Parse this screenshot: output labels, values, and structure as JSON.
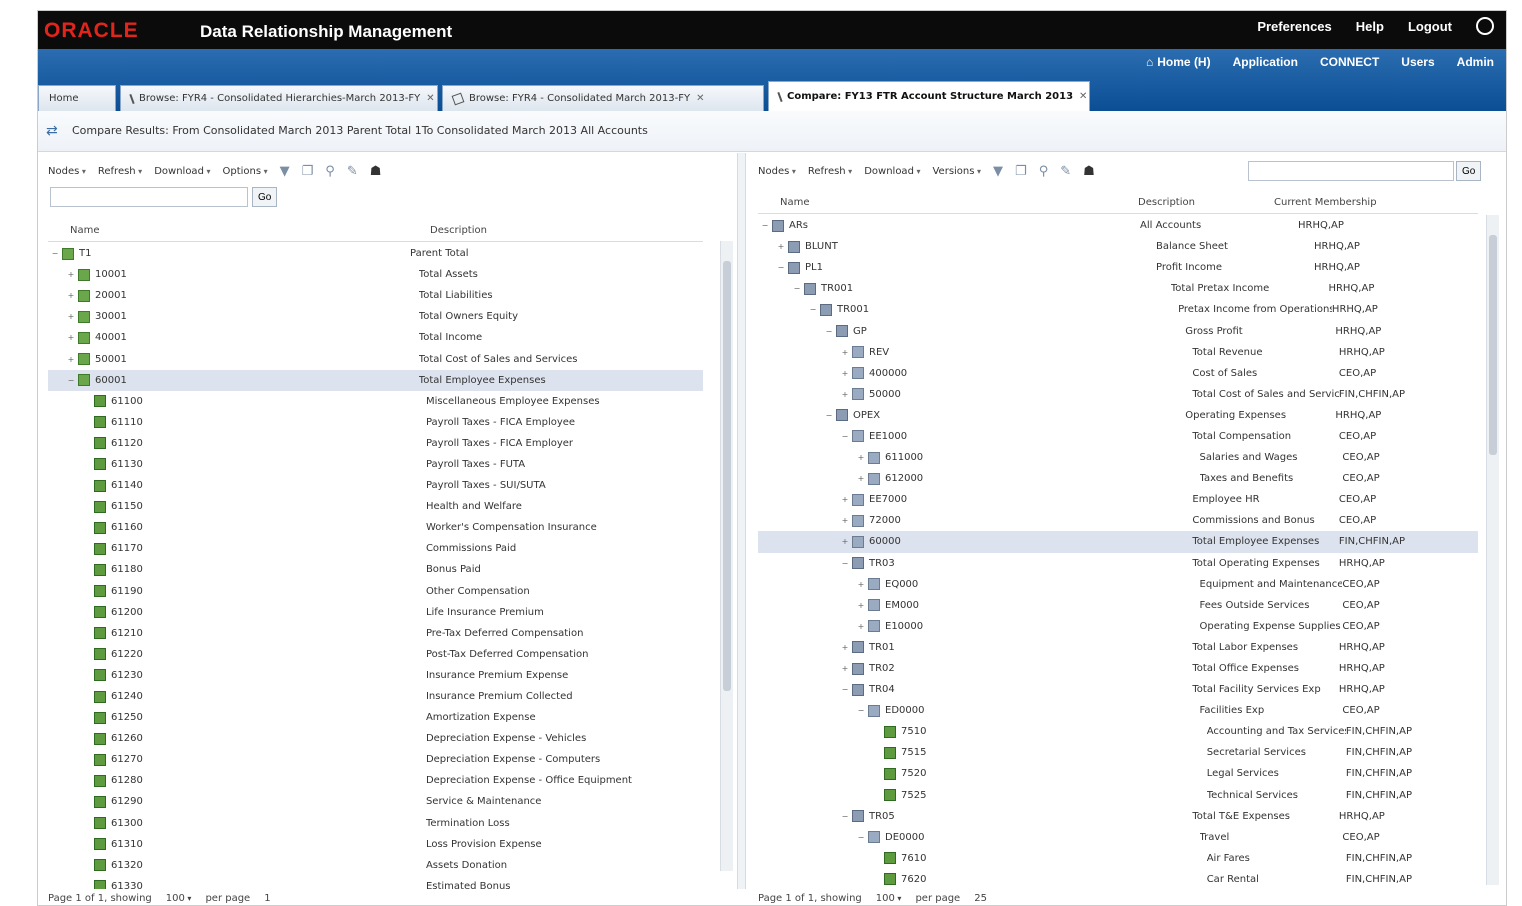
{
  "app": {
    "brand": "ORACLE",
    "product": "Data Relationship Management",
    "top_links": [
      "Preferences",
      "Help",
      "Logout"
    ]
  },
  "nav": {
    "links": [
      "Home (H)",
      "Application",
      "CONNECT",
      "Users",
      "Admin"
    ]
  },
  "tabs": [
    {
      "label": "Home",
      "active": false
    },
    {
      "label": "Browse: FYR4 - Consolidated Hierarchies-March 2013-FY",
      "active": false
    },
    {
      "label": "Browse: FYR4 - Consolidated March 2013-FY",
      "active": false
    },
    {
      "label": "Compare: FY13 FTR Account Structure March 2013",
      "active": true
    }
  ],
  "compare_title": "Compare Results: From Consolidated March 2013 Parent Total 1To Consolidated March 2013 All Accounts",
  "left_pane": {
    "menus": [
      "Nodes",
      "Refresh",
      "Download",
      "Options"
    ],
    "search_button": "Go",
    "columns": [
      "Name",
      "Description"
    ],
    "rows": [
      {
        "exp": "−",
        "icon": "grp",
        "indent": 0,
        "name": "T1",
        "desc": "Parent Total"
      },
      {
        "exp": "+",
        "icon": "grp",
        "indent": 1,
        "name": "10001",
        "desc": "Total Assets"
      },
      {
        "exp": "+",
        "icon": "grp",
        "indent": 1,
        "name": "20001",
        "desc": "Total Liabilities"
      },
      {
        "exp": "+",
        "icon": "grp",
        "indent": 1,
        "name": "30001",
        "desc": "Total Owners Equity"
      },
      {
        "exp": "+",
        "icon": "grp",
        "indent": 1,
        "name": "40001",
        "desc": "Total Income"
      },
      {
        "exp": "+",
        "icon": "grp",
        "indent": 1,
        "name": "50001",
        "desc": "Total Cost of Sales and Services"
      },
      {
        "exp": "−",
        "icon": "grp",
        "indent": 1,
        "name": "60001",
        "desc": "Total Employee Expenses",
        "sel": true
      },
      {
        "exp": "",
        "icon": "leaf",
        "indent": 2,
        "name": "61100",
        "desc": "Miscellaneous Employee Expenses"
      },
      {
        "exp": "",
        "icon": "leaf",
        "indent": 2,
        "name": "61110",
        "desc": "Payroll Taxes - FICA Employee"
      },
      {
        "exp": "",
        "icon": "leaf",
        "indent": 2,
        "name": "61120",
        "desc": "Payroll Taxes - FICA Employer"
      },
      {
        "exp": "",
        "icon": "leaf",
        "indent": 2,
        "name": "61130",
        "desc": "Payroll Taxes - FUTA"
      },
      {
        "exp": "",
        "icon": "leaf",
        "indent": 2,
        "name": "61140",
        "desc": "Payroll Taxes - SUI/SUTA"
      },
      {
        "exp": "",
        "icon": "leaf",
        "indent": 2,
        "name": "61150",
        "desc": "Health and Welfare"
      },
      {
        "exp": "",
        "icon": "leaf",
        "indent": 2,
        "name": "61160",
        "desc": "Worker's Compensation Insurance"
      },
      {
        "exp": "",
        "icon": "leaf",
        "indent": 2,
        "name": "61170",
        "desc": "Commissions Paid"
      },
      {
        "exp": "",
        "icon": "leaf",
        "indent": 2,
        "name": "61180",
        "desc": "Bonus Paid"
      },
      {
        "exp": "",
        "icon": "leaf",
        "indent": 2,
        "name": "61190",
        "desc": "Other Compensation"
      },
      {
        "exp": "",
        "icon": "leaf",
        "indent": 2,
        "name": "61200",
        "desc": "Life Insurance Premium"
      },
      {
        "exp": "",
        "icon": "leaf",
        "indent": 2,
        "name": "61210",
        "desc": "Pre-Tax Deferred Compensation"
      },
      {
        "exp": "",
        "icon": "leaf",
        "indent": 2,
        "name": "61220",
        "desc": "Post-Tax Deferred Compensation"
      },
      {
        "exp": "",
        "icon": "leaf",
        "indent": 2,
        "name": "61230",
        "desc": "Insurance Premium Expense"
      },
      {
        "exp": "",
        "icon": "leaf",
        "indent": 2,
        "name": "61240",
        "desc": "Insurance Premium Collected"
      },
      {
        "exp": "",
        "icon": "leaf",
        "indent": 2,
        "name": "61250",
        "desc": "Amortization Expense"
      },
      {
        "exp": "",
        "icon": "leaf",
        "indent": 2,
        "name": "61260",
        "desc": "Depreciation Expense - Vehicles"
      },
      {
        "exp": "",
        "icon": "leaf",
        "indent": 2,
        "name": "61270",
        "desc": "Depreciation Expense - Computers"
      },
      {
        "exp": "",
        "icon": "leaf",
        "indent": 2,
        "name": "61280",
        "desc": "Depreciation Expense - Office Equipment"
      },
      {
        "exp": "",
        "icon": "leaf",
        "indent": 2,
        "name": "61290",
        "desc": "Service & Maintenance"
      },
      {
        "exp": "",
        "icon": "leaf",
        "indent": 2,
        "name": "61300",
        "desc": "Termination Loss"
      },
      {
        "exp": "",
        "icon": "leaf",
        "indent": 2,
        "name": "61310",
        "desc": "Loss Provision Expense"
      },
      {
        "exp": "",
        "icon": "leaf",
        "indent": 2,
        "name": "61320",
        "desc": "Assets Donation"
      },
      {
        "exp": "",
        "icon": "leaf",
        "indent": 2,
        "name": "61330",
        "desc": "Estimated Bonus"
      }
    ],
    "footer": {
      "page_text": "Page 1 of 1, showing",
      "count": "100",
      "per_page_label": "per page",
      "page_num": "1"
    }
  },
  "right_pane": {
    "menus": [
      "Nodes",
      "Refresh",
      "Download",
      "Versions"
    ],
    "search_button": "Go",
    "columns": [
      "Name",
      "Description",
      "Current Membership"
    ],
    "rows": [
      {
        "exp": "−",
        "icon": "hier",
        "indent": 0,
        "name": "ARs",
        "desc": "All Accounts",
        "role": "HRHQ,AP"
      },
      {
        "exp": "+",
        "icon": "hier",
        "indent": 1,
        "name": "BLUNT",
        "desc": "Balance Sheet",
        "role": "HRHQ,AP"
      },
      {
        "exp": "−",
        "icon": "hier",
        "indent": 1,
        "name": "PL1",
        "desc": "Profit Income",
        "role": "HRHQ,AP"
      },
      {
        "exp": "−",
        "icon": "hier",
        "indent": 2,
        "name": "TR001",
        "desc": "Total Pretax Income",
        "role": "HRHQ,AP"
      },
      {
        "exp": "−",
        "icon": "hier",
        "indent": 3,
        "name": "TR001",
        "desc": "Pretax Income from Operations",
        "role": "HRHQ,AP"
      },
      {
        "exp": "−",
        "icon": "hier",
        "indent": 4,
        "name": "GP",
        "desc": "Gross Profit",
        "role": "HRHQ,AP"
      },
      {
        "exp": "+",
        "icon": "fold",
        "indent": 5,
        "name": "REV",
        "desc": "Total Revenue",
        "role": "HRHQ,AP"
      },
      {
        "exp": "+",
        "icon": "fold",
        "indent": 5,
        "name": "400000",
        "desc": "Cost of Sales",
        "role": "CEO,AP"
      },
      {
        "exp": "+",
        "icon": "fold",
        "indent": 5,
        "name": "50000",
        "desc": "Total Cost of Sales and Services",
        "role": "FIN,CHFIN,AP"
      },
      {
        "exp": "−",
        "icon": "hier",
        "indent": 4,
        "name": "OPEX",
        "desc": "Operating Expenses",
        "role": "HRHQ,AP"
      },
      {
        "exp": "−",
        "icon": "fold",
        "indent": 5,
        "name": "EE1000",
        "desc": "Total Compensation",
        "role": "CEO,AP"
      },
      {
        "exp": "+",
        "icon": "fold",
        "indent": 6,
        "name": "611000",
        "desc": "Salaries and Wages",
        "role": "CEO,AP"
      },
      {
        "exp": "+",
        "icon": "fold",
        "indent": 6,
        "name": "612000",
        "desc": "Taxes and Benefits",
        "role": "CEO,AP"
      },
      {
        "exp": "+",
        "icon": "fold",
        "indent": 5,
        "name": "EE7000",
        "desc": "Employee HR",
        "role": "CEO,AP"
      },
      {
        "exp": "+",
        "icon": "fold",
        "indent": 5,
        "name": "72000",
        "desc": "Commissions and Bonus",
        "role": "CEO,AP"
      },
      {
        "exp": "+",
        "icon": "fold",
        "indent": 5,
        "name": "60000",
        "desc": "Total Employee Expenses",
        "role": "FIN,CHFIN,AP",
        "sel": true
      },
      {
        "exp": "−",
        "icon": "hier",
        "indent": 5,
        "name": "TR03",
        "desc": "Total Operating Expenses",
        "role": "HRHQ,AP"
      },
      {
        "exp": "+",
        "icon": "fold",
        "indent": 6,
        "name": "EQ000",
        "desc": "Equipment and Maintenance",
        "role": "CEO,AP"
      },
      {
        "exp": "+",
        "icon": "fold",
        "indent": 6,
        "name": "EM000",
        "desc": "Fees Outside Services",
        "role": "CEO,AP"
      },
      {
        "exp": "+",
        "icon": "fold",
        "indent": 6,
        "name": "E10000",
        "desc": "Operating Expense Supplies",
        "role": "CEO,AP"
      },
      {
        "exp": "+",
        "icon": "hier",
        "indent": 5,
        "name": "TR01",
        "desc": "Total Labor Expenses",
        "role": "HRHQ,AP"
      },
      {
        "exp": "+",
        "icon": "hier",
        "indent": 5,
        "name": "TR02",
        "desc": "Total Office Expenses",
        "role": "HRHQ,AP"
      },
      {
        "exp": "−",
        "icon": "hier",
        "indent": 5,
        "name": "TR04",
        "desc": "Total Facility Services Exp",
        "role": "HRHQ,AP"
      },
      {
        "exp": "−",
        "icon": "fold",
        "indent": 6,
        "name": "ED0000",
        "desc": "Facilities Exp",
        "role": "CEO,AP"
      },
      {
        "exp": "",
        "icon": "leaf",
        "indent": 7,
        "name": "7510",
        "desc": "Accounting and Tax Services",
        "role": "FIN,CHFIN,AP"
      },
      {
        "exp": "",
        "icon": "leaf",
        "indent": 7,
        "name": "7515",
        "desc": "Secretarial Services",
        "role": "FIN,CHFIN,AP"
      },
      {
        "exp": "",
        "icon": "leaf",
        "indent": 7,
        "name": "7520",
        "desc": "Legal Services",
        "role": "FIN,CHFIN,AP"
      },
      {
        "exp": "",
        "icon": "leaf",
        "indent": 7,
        "name": "7525",
        "desc": "Technical Services",
        "role": "FIN,CHFIN,AP"
      },
      {
        "exp": "−",
        "icon": "hier",
        "indent": 5,
        "name": "TR05",
        "desc": "Total T&E Expenses",
        "role": "HRHQ,AP"
      },
      {
        "exp": "−",
        "icon": "fold",
        "indent": 6,
        "name": "DE0000",
        "desc": "Travel",
        "role": "CEO,AP"
      },
      {
        "exp": "",
        "icon": "leaf",
        "indent": 7,
        "name": "7610",
        "desc": "Air Fares",
        "role": "FIN,CHFIN,AP"
      },
      {
        "exp": "",
        "icon": "leaf",
        "indent": 7,
        "name": "7620",
        "desc": "Car Rental",
        "role": "FIN,CHFIN,AP"
      }
    ],
    "footer": {
      "page_text": "Page 1 of 1, showing",
      "count": "100",
      "per_page_label": "per page",
      "page_num": "25"
    }
  }
}
